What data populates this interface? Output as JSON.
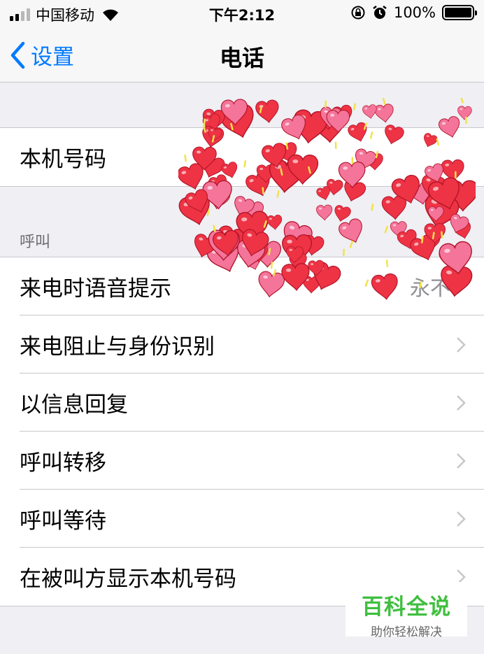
{
  "status_bar": {
    "carrier": "中国移动",
    "time": "下午2:12",
    "battery_text": "100%",
    "battery_level": 1.0,
    "signal_bars": 2,
    "icons": [
      "signal-icon",
      "wifi-icon",
      "rotation-lock-icon",
      "alarm-icon",
      "battery-icon"
    ]
  },
  "nav": {
    "back_label": "设置",
    "title": "电话"
  },
  "groups": {
    "my_number": {
      "label": "本机号码"
    },
    "calls_header": "呼叫",
    "calls": [
      {
        "label": "来电时语音提示",
        "value": "永不"
      },
      {
        "label": "来电阻止与身份识别"
      },
      {
        "label": "以信息回复"
      },
      {
        "label": "呼叫转移"
      },
      {
        "label": "呼叫等待"
      },
      {
        "label": "在被叫方显示本机号码"
      }
    ]
  },
  "watermark": {
    "title": "百科全说",
    "subtitle": "助你轻松解决",
    "title_color": "#3fbf3f"
  },
  "colors": {
    "accent": "#007aff",
    "background": "#efeff4",
    "separator": "#c8c7cc",
    "secondary_text": "#8e8e93",
    "heart_red": "#ee3344",
    "heart_pink": "#f4749a"
  }
}
